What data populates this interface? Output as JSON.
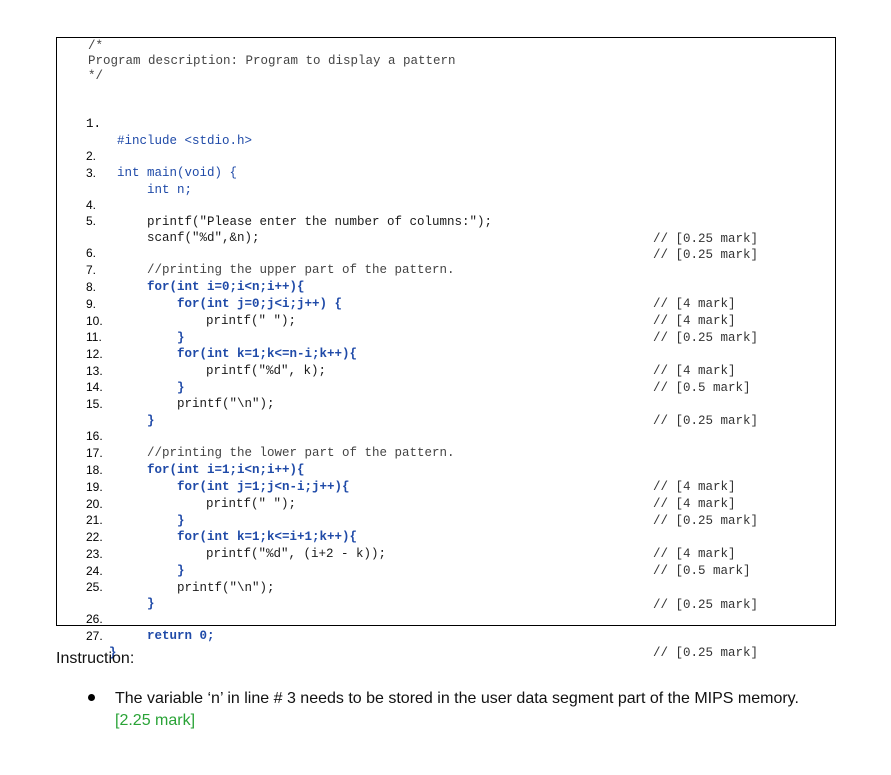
{
  "code": {
    "header": [
      "/*",
      "Program description: Program to display a pattern",
      "*/"
    ],
    "lines": [
      {
        "n": "1.",
        "text": "#include <stdio.h>",
        "comment": ""
      },
      {
        "n": "2.",
        "text": "int main(void) {",
        "comment": ""
      },
      {
        "n": "3.",
        "text": "int n;",
        "comment": ""
      },
      {
        "n": "4.",
        "text": "printf(\"Please enter the number of columns:\");",
        "comment": "// [0.25 mark]"
      },
      {
        "n": "5.",
        "text": "scanf(\"%d\",&n);",
        "comment": "// [0.25 mark]"
      },
      {
        "n": "6.",
        "text": "//printing the upper part of the pattern.",
        "comment": ""
      },
      {
        "n": "7.",
        "text": "for(int i=0;i<n;i++){",
        "comment": "// [4 mark]"
      },
      {
        "n": "8.",
        "text": "for(int j=0;j<i;j++) {",
        "comment": "// [4 mark]"
      },
      {
        "n": "9.",
        "text": "printf(\" \");",
        "comment": "// [0.25 mark]"
      },
      {
        "n": "10.",
        "text": "}",
        "comment": ""
      },
      {
        "n": "11.",
        "text": "for(int k=1;k<=n-i;k++){",
        "comment": "// [4 mark]"
      },
      {
        "n": "12.",
        "text": "printf(\"%d\", k);",
        "comment": "// [0.5 mark]"
      },
      {
        "n": "13.",
        "text": "}",
        "comment": ""
      },
      {
        "n": "14.",
        "text": "printf(\"\\n\");",
        "comment": "// [0.25 mark]"
      },
      {
        "n": "15.",
        "text": "}",
        "comment": ""
      },
      {
        "n": "16.",
        "text": "//printing the lower part of the pattern.",
        "comment": ""
      },
      {
        "n": "17.",
        "text": "for(int i=1;i<n;i++){",
        "comment": "// [4 mark]"
      },
      {
        "n": "18.",
        "text": "for(int j=1;j<n-i;j++){",
        "comment": "// [4 mark]"
      },
      {
        "n": "19.",
        "text": "printf(\" \");",
        "comment": "// [0.25 mark]"
      },
      {
        "n": "20.",
        "text": "}",
        "comment": ""
      },
      {
        "n": "21.",
        "text": "for(int k=1;k<=i+1;k++){",
        "comment": "// [4 mark]"
      },
      {
        "n": "22.",
        "text": "printf(\"%d\", (i+2 - k));",
        "comment": "// [0.5 mark]"
      },
      {
        "n": "23.",
        "text": "}",
        "comment": ""
      },
      {
        "n": "24.",
        "text": "printf(\"\\n\");",
        "comment": "// [0.25 mark]"
      },
      {
        "n": "25.",
        "text": "}",
        "comment": ""
      },
      {
        "n": "26.",
        "text": "return 0;",
        "comment": "// [0.25 mark]"
      },
      {
        "n": "27.",
        "text": "}",
        "comment": ""
      }
    ]
  },
  "instruction": {
    "title": "Instruction:",
    "bullet_text": "The variable ‘n’ in line # 3 needs to be stored in the user data segment part of the MIPS memory.",
    "bullet_mark": "[2.25 mark]"
  },
  "colors": {
    "keyword": "#1f4aa8",
    "string": "#888888",
    "number": "#7fa0d8",
    "mark": "#29a336"
  }
}
